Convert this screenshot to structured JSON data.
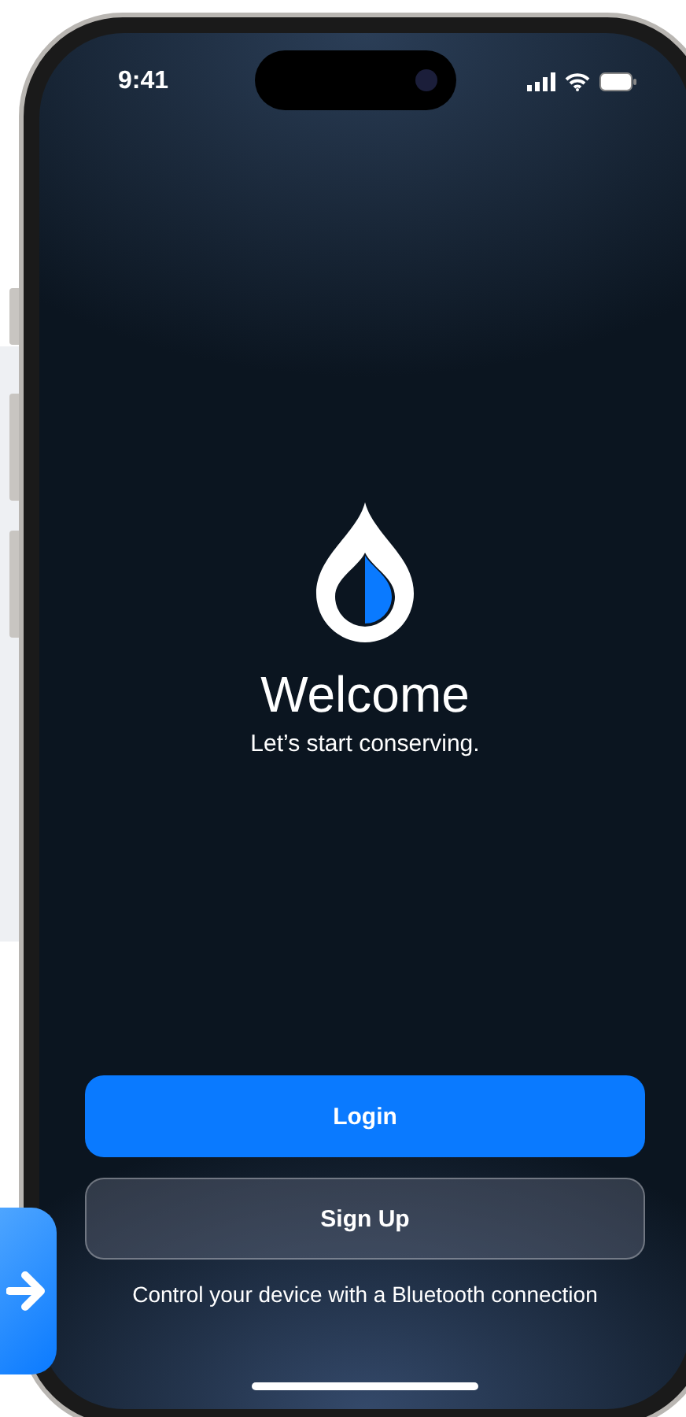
{
  "status_bar": {
    "time": "9:41"
  },
  "welcome": {
    "title": "Welcome",
    "subtitle": "Let’s start conserving."
  },
  "buttons": [
    {
      "label": "Login",
      "kind": "primary"
    },
    {
      "label": "Sign Up",
      "kind": "secondary"
    }
  ],
  "footer": "Control your device with a Bluetooth connection"
}
